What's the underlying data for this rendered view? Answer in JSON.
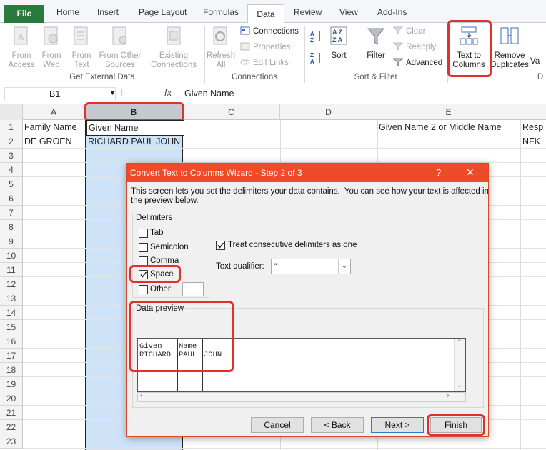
{
  "tabs": [
    "File",
    "Home",
    "Insert",
    "Page Layout",
    "Formulas",
    "Data",
    "Review",
    "View",
    "Add-Ins"
  ],
  "active_tab": "Data",
  "ribbon": {
    "get_external": {
      "from_access": "From\nAccess",
      "from_web": "From\nWeb",
      "from_text": "From\nText",
      "from_other": "From Other\nSources",
      "existing": "Existing\nConnections",
      "group_label": "Get External Data"
    },
    "connections": {
      "refresh_all": "Refresh\nAll",
      "connections": "Connections",
      "properties": "Properties",
      "edit_links": "Edit Links",
      "group_label": "Connections"
    },
    "sort_filter": {
      "sort": "Sort",
      "filter": "Filter",
      "clear": "Clear",
      "reapply": "Reapply",
      "advanced": "Advanced",
      "group_label": "Sort & Filter"
    },
    "data_tools": {
      "text_to_columns": "Text to\nColumns",
      "remove_duplicates": "Remove\nDuplicates",
      "validation_partial": "Va",
      "group_label_partial": "D"
    }
  },
  "formula_bar": {
    "name_box": "B1",
    "fx": "fx",
    "content": "Given Name"
  },
  "columns": [
    "A",
    "B",
    "C",
    "D",
    "E"
  ],
  "rows": [
    "1",
    "2",
    "3",
    "4",
    "5",
    "6",
    "7",
    "8",
    "9",
    "10",
    "11",
    "12",
    "13",
    "14",
    "15",
    "16",
    "17",
    "18",
    "19",
    "20",
    "21",
    "22",
    "23"
  ],
  "cells": {
    "A1": "Family Name",
    "B1": "Given Name",
    "E1": "Given Name 2 or Middle Name",
    "F1": "Resp",
    "A2": "DE GROEN",
    "B2": "RICHARD PAUL JOHN",
    "F2": "NFK"
  },
  "dialog": {
    "title": "Convert Text to Columns Wizard - Step 2 of 3",
    "help": "?",
    "close": "✕",
    "description": "This screen lets you set the delimiters your data contains.  You can see how your text is affected in\nthe preview below.",
    "delimiters_label": "Delimiters",
    "tab": "Tab",
    "semicolon": "Semicolon",
    "comma": "Comma",
    "space": "Space",
    "other": "Other:",
    "space_checked": true,
    "consecutive_label": "Treat consecutive delimiters as one",
    "consecutive_checked": true,
    "qualifier_label": "Text qualifier:",
    "qualifier_value": "\"",
    "preview_label": "Data preview",
    "preview_columns": [
      [
        "Given",
        "RICHARD"
      ],
      [
        "Name",
        "PAUL"
      ],
      [
        "",
        "JOHN"
      ]
    ],
    "buttons": {
      "cancel": "Cancel",
      "back": "< Back",
      "next": "Next >",
      "finish": "Finish"
    }
  },
  "colors": {
    "accent": "#e0312c",
    "title_bar": "#ef4b28",
    "file_tab": "#2a7a3e",
    "selection": "#cfe3f8"
  }
}
